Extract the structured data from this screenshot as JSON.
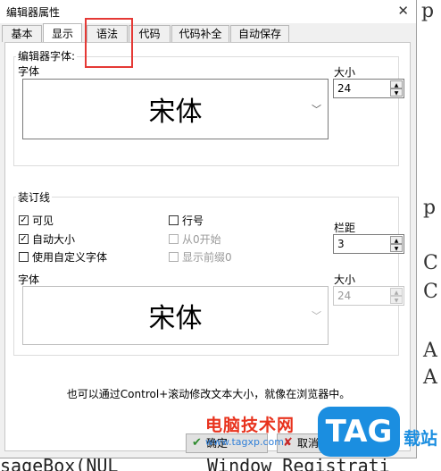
{
  "window": {
    "title": "编辑器属性",
    "close": "✕"
  },
  "tabs": [
    {
      "label": "基本"
    },
    {
      "label": "显示",
      "active": true
    },
    {
      "label": "语法"
    },
    {
      "label": "代码"
    },
    {
      "label": "代码补全"
    },
    {
      "label": "自动保存"
    }
  ],
  "editor_font": {
    "group": "编辑器字体:",
    "font_label": "字体",
    "font_value": "宋体",
    "size_label": "大小",
    "size_value": "24"
  },
  "gutter": {
    "group": "装订线",
    "visible": {
      "label": "可见",
      "checked": true
    },
    "auto_size": {
      "label": "自动大小",
      "checked": true
    },
    "custom_font": {
      "label": "使用自定义字体",
      "checked": false
    },
    "line_numbers": {
      "label": "行号",
      "checked": false
    },
    "start_zero": {
      "label": "从0开始",
      "checked": false
    },
    "show_leading_zero": {
      "label": "显示前缀0",
      "checked": false
    },
    "margin_label": "栏距",
    "margin_value": "3",
    "font_label": "字体",
    "font_value": "宋体",
    "size_label": "大小",
    "size_value": "24"
  },
  "hint": "也可以通过Control+滚动修改文本大小，就像在浏览器中。",
  "buttons": {
    "ok": "确定",
    "cancel": "取消"
  },
  "watermark": {
    "text": "电脑技术网",
    "url": "www.tagxp.com",
    "logo": "TAG",
    "tail": "载站"
  },
  "background": {
    "right_chars": [
      "p",
      "C",
      "C",
      "A",
      "A"
    ],
    "bottom_left": "sageBox(NUL",
    "bottom_right": "Window Registrati"
  },
  "colors": {
    "highlight": "#e53935",
    "watermark_red": "#e8331e",
    "watermark_blue": "#1b8ee0"
  }
}
